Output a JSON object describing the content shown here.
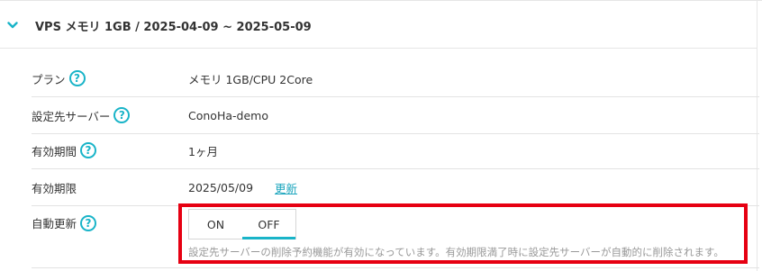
{
  "header": {
    "title": "VPS メモリ 1GB / 2025-04-09 ~ 2025-05-09",
    "expand_icon": "chevron-down-icon"
  },
  "rows": [
    {
      "label": "プラン",
      "value": "メモリ 1GB/CPU 2Core",
      "help": "?"
    },
    {
      "label": "設定先サーバー",
      "value": "ConoHa-demo",
      "help": "?"
    },
    {
      "label": "有効期間",
      "value": "1ヶ月",
      "help": "?"
    },
    {
      "label": "有効期限",
      "value": "2025/05/09",
      "link": "更新"
    }
  ],
  "auto_renew": {
    "label": "自動更新",
    "help": "?",
    "on_label": "ON",
    "off_label": "OFF",
    "selected": "OFF",
    "notice": "設定先サーバーの削除予約機能が有効になっています。有効期限満了時に設定先サーバーが自動的に削除されます。"
  },
  "colors": {
    "accent": "#19b4c8",
    "link": "#1aa5bd",
    "highlight": "#e60012",
    "muted_text": "#999999"
  }
}
